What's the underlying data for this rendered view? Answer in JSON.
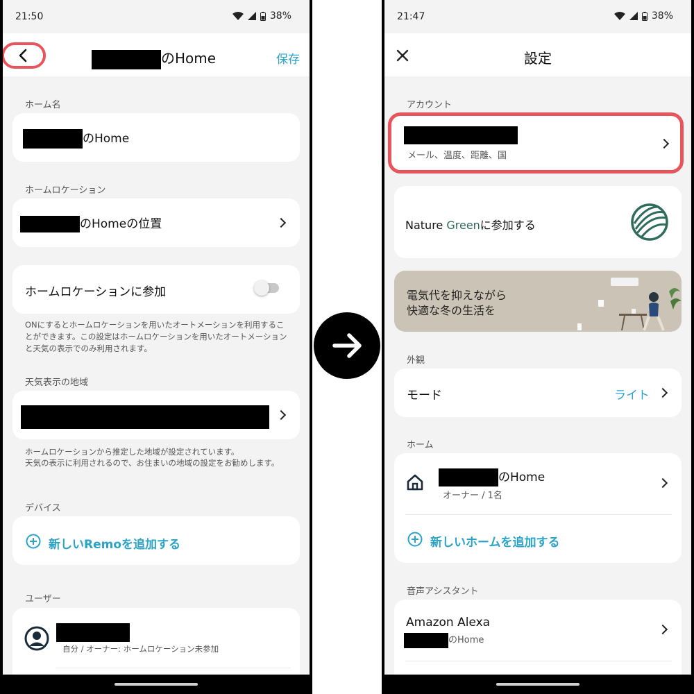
{
  "left": {
    "status": {
      "time": "21:50",
      "battery": "38%"
    },
    "header": {
      "title_suffix": "のHome",
      "save_label": "保存"
    },
    "home_name": {
      "label": "ホーム名",
      "value_suffix": "のHome"
    },
    "home_location": {
      "label": "ホームロケーション",
      "value_suffix": "のHomeの位置"
    },
    "participate": {
      "label": "ホームロケーションに参加",
      "help": "ONにするとホームロケーションを用いたオートメーションを利用することができます。この設定はホームロケーションを用いたオートメーションと天気の表示でのみ利用されます。"
    },
    "weather": {
      "label": "天気表示の地域",
      "help1": "ホームロケーションから推定した地域が設定されています。",
      "help2": "天気の表示に利用されるので、お住まいの地域の設定をお勧めします。"
    },
    "devices": {
      "label": "デバイス",
      "add_label": "新しいRemoを追加する"
    },
    "users": {
      "label": "ユーザー",
      "user_sub": "自分 / オーナー: ホームロケーション未参加"
    }
  },
  "right": {
    "status": {
      "time": "21:47",
      "battery": "38%"
    },
    "header": {
      "title": "設定"
    },
    "account": {
      "label": "アカウント",
      "sub": "メール、温度、距離、国"
    },
    "nature_green": {
      "prefix": "Nature ",
      "green": "Green",
      "suffix": "に参加する"
    },
    "banner": {
      "line1": "電気代を抑えながら",
      "line2": "快適な冬の生活を"
    },
    "appearance": {
      "label": "外観",
      "mode_label": "モード",
      "mode_value": "ライト"
    },
    "home": {
      "label": "ホーム",
      "home_suffix": "のHome",
      "home_sub": "オーナー / 1名",
      "add_label": "新しいホームを追加する"
    },
    "voice": {
      "label": "音声アシスタント",
      "alexa_label": "Amazon Alexa",
      "alexa_sub_suffix": "のHome"
    }
  },
  "colors": {
    "accent": "#2aa3c8",
    "highlight": "#e8545c",
    "green": "#2e6b5a",
    "banner_bg": "#cbc4b6"
  },
  "icons": [
    "back-arrow-icon",
    "close-icon",
    "arrow-right-icon",
    "home-icon",
    "add-circle-icon",
    "user-avatar-icon",
    "nature-green-logo-icon",
    "wifi-icon",
    "signal-icon",
    "battery-icon"
  ]
}
